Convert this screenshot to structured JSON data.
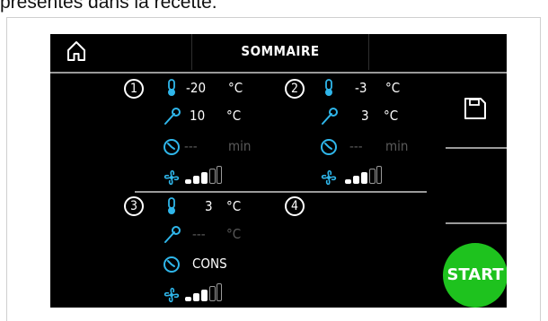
{
  "document": {
    "text": "présentés dans la recette."
  },
  "header": {
    "title": "SOMMAIRE",
    "home_icon": "home-icon"
  },
  "sides": {
    "save_icon": "save-icon",
    "start_label": "START",
    "start_color": "#1ec21e"
  },
  "sections": [
    {
      "number": "1",
      "temperature": {
        "value": "-20",
        "unit": "°C"
      },
      "probe": {
        "value": "10",
        "unit": "°C"
      },
      "time": {
        "value": "---",
        "unit": "min"
      },
      "fan_level": 3
    },
    {
      "number": "2",
      "temperature": {
        "value": "-3",
        "unit": "°C"
      },
      "probe": {
        "value": "3",
        "unit": "°C"
      },
      "time": {
        "value": "---",
        "unit": "min"
      },
      "fan_level": 3
    },
    {
      "number": "3",
      "temperature": {
        "value": "3",
        "unit": "°C"
      },
      "probe": {
        "value": "---",
        "unit": "°C"
      },
      "time": {
        "value": "CONS",
        "unit": ""
      },
      "fan_level": 3
    },
    {
      "number": "4"
    }
  ],
  "colors": {
    "thermometer": "#2fb6ea",
    "probe": "#2fb6ea",
    "clock": "#2fb6ea",
    "fan": "#2fb6ea",
    "dim_text": "#5a5a5a"
  }
}
